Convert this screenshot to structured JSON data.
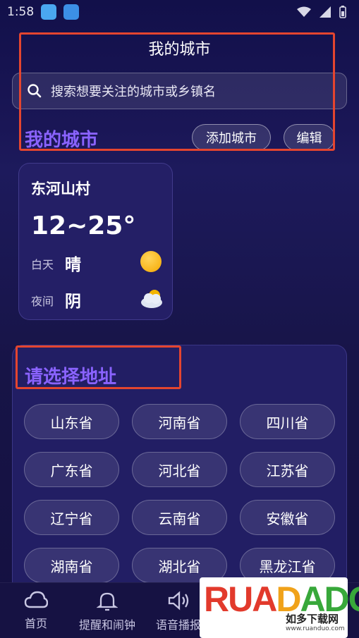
{
  "status": {
    "time": "1:58",
    "apps": [
      "weather-app-icon",
      "cloud-app-icon"
    ]
  },
  "header": {
    "title": "我的城市"
  },
  "search": {
    "placeholder": "搜索想要关注的城市或乡镇名"
  },
  "my_cities": {
    "section_title": "我的城市",
    "add_label": "添加城市",
    "edit_label": "编辑"
  },
  "city_card": {
    "name": "东河山村",
    "temp_range": "12~25°",
    "day": {
      "label": "白天",
      "condition": "晴",
      "icon": "sun-icon"
    },
    "night": {
      "label": "夜间",
      "condition": "阴",
      "icon": "cloud-icon"
    }
  },
  "address": {
    "section_title": "请选择地址",
    "provinces": [
      "山东省",
      "河南省",
      "四川省",
      "广东省",
      "河北省",
      "江苏省",
      "辽宁省",
      "云南省",
      "安徽省",
      "湖南省",
      "湖北省",
      "黑龙江省"
    ]
  },
  "bottom_nav": {
    "items": [
      {
        "label": "首页",
        "icon": "cloud-home-icon"
      },
      {
        "label": "提醒和闹钟",
        "icon": "bell-icon"
      },
      {
        "label": "语音播报",
        "icon": "speaker-icon"
      }
    ]
  },
  "watermark": {
    "logo": "RUANDUO",
    "cn": "如多下载网",
    "url": "www.ruanduo.com"
  },
  "colors": {
    "accent": "#8a63ff",
    "highlight": "#e4452f",
    "background": "#1a1656"
  }
}
